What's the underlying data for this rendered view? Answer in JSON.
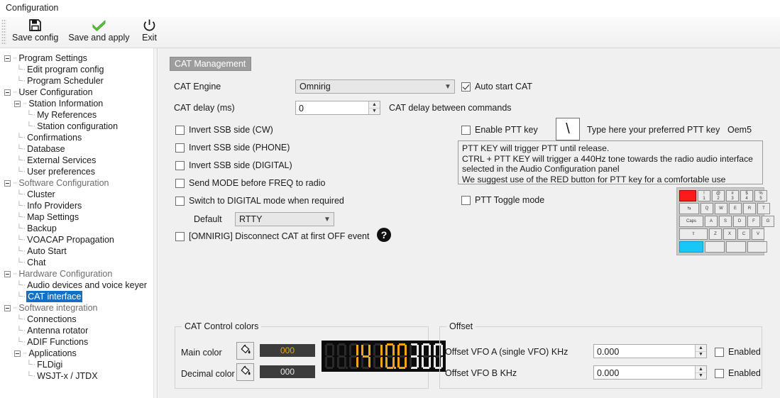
{
  "window": {
    "title": "Configuration"
  },
  "toolbar": {
    "items": [
      {
        "label": "Save config",
        "icon": "floppy-disk-icon"
      },
      {
        "label": "Save and apply",
        "icon": "green-check-icon"
      },
      {
        "label": "Exit",
        "icon": "power-icon"
      }
    ]
  },
  "sidebar": {
    "items": [
      {
        "label": "Program Settings",
        "indent": 0,
        "expander": true,
        "grey": false,
        "selected": false
      },
      {
        "label": "Edit program config",
        "indent": 1,
        "expander": false,
        "grey": false,
        "selected": false
      },
      {
        "label": "Program Scheduler",
        "indent": 1,
        "expander": false,
        "grey": false,
        "selected": false
      },
      {
        "label": "User Configuration",
        "indent": 0,
        "expander": true,
        "grey": false,
        "selected": false
      },
      {
        "label": "Station Information",
        "indent": 1,
        "expander": true,
        "grey": false,
        "selected": false
      },
      {
        "label": "My References",
        "indent": 2,
        "expander": false,
        "grey": false,
        "selected": false
      },
      {
        "label": "Station configuration",
        "indent": 2,
        "expander": false,
        "grey": false,
        "selected": false
      },
      {
        "label": "Confirmations",
        "indent": 1,
        "expander": false,
        "grey": false,
        "selected": false
      },
      {
        "label": "Database",
        "indent": 1,
        "expander": false,
        "grey": false,
        "selected": false
      },
      {
        "label": "External Services",
        "indent": 1,
        "expander": false,
        "grey": false,
        "selected": false
      },
      {
        "label": "User preferences",
        "indent": 1,
        "expander": false,
        "grey": false,
        "selected": false
      },
      {
        "label": "Software Configuration",
        "indent": 0,
        "expander": true,
        "grey": true,
        "selected": false
      },
      {
        "label": "Cluster",
        "indent": 1,
        "expander": false,
        "grey": false,
        "selected": false
      },
      {
        "label": "Info Providers",
        "indent": 1,
        "expander": false,
        "grey": false,
        "selected": false
      },
      {
        "label": "Map Settings",
        "indent": 1,
        "expander": false,
        "grey": false,
        "selected": false
      },
      {
        "label": "Backup",
        "indent": 1,
        "expander": false,
        "grey": false,
        "selected": false
      },
      {
        "label": "VOACAP Propagation",
        "indent": 1,
        "expander": false,
        "grey": false,
        "selected": false
      },
      {
        "label": "Auto Start",
        "indent": 1,
        "expander": false,
        "grey": false,
        "selected": false
      },
      {
        "label": "Chat",
        "indent": 1,
        "expander": false,
        "grey": false,
        "selected": false
      },
      {
        "label": "Hardware Configuration",
        "indent": 0,
        "expander": true,
        "grey": true,
        "selected": false
      },
      {
        "label": "Audio devices and voice keyer",
        "indent": 1,
        "expander": false,
        "grey": false,
        "selected": false
      },
      {
        "label": "CAT interface",
        "indent": 1,
        "expander": false,
        "grey": false,
        "selected": true
      },
      {
        "label": "Software integration",
        "indent": 0,
        "expander": true,
        "grey": true,
        "selected": false
      },
      {
        "label": "Connections",
        "indent": 1,
        "expander": false,
        "grey": false,
        "selected": false
      },
      {
        "label": "Antenna rotator",
        "indent": 1,
        "expander": false,
        "grey": false,
        "selected": false
      },
      {
        "label": "ADIF Functions",
        "indent": 1,
        "expander": false,
        "grey": false,
        "selected": false
      },
      {
        "label": "Applications",
        "indent": 1,
        "expander": true,
        "grey": false,
        "selected": false
      },
      {
        "label": "FLDigi",
        "indent": 2,
        "expander": false,
        "grey": false,
        "selected": false
      },
      {
        "label": "WSJT-x / JTDX",
        "indent": 2,
        "expander": false,
        "grey": false,
        "selected": false
      }
    ]
  },
  "main": {
    "group_title": "CAT Management",
    "cat_engine": {
      "label": "CAT Engine",
      "value": "Omnirig"
    },
    "cat_delay": {
      "label": "CAT delay (ms)",
      "value": "0",
      "hint": "CAT delay between commands"
    },
    "auto_start_cat": {
      "label": "Auto start CAT",
      "checked": true
    },
    "checkboxes": [
      {
        "label": "Invert SSB side (CW)",
        "checked": false
      },
      {
        "label": "Invert SSB side (PHONE)",
        "checked": false
      },
      {
        "label": "Invert SSB side (DIGITAL)",
        "checked": false
      },
      {
        "label": "Send MODE before FREQ to radio",
        "checked": false
      },
      {
        "label": "Switch to DIGITAL mode when required",
        "checked": false
      }
    ],
    "default_mode": {
      "label": "Default",
      "value": "RTTY"
    },
    "omnirig_disconnect": {
      "label": "[OMNIRIG] Disconnect CAT at first OFF event",
      "checked": false
    },
    "help_icon": "question-mark-icon",
    "enable_ptt_key": {
      "label": "Enable PTT key",
      "checked": false
    },
    "ptt_key_box": {
      "value": "\\"
    },
    "ptt_key_hint": "Type here your preferred PTT key",
    "ptt_key_name": "Oem5",
    "ptt_info_lines": [
      "PTT KEY will trigger PTT until release.",
      "CTRL + PTT KEY will trigger a 440Hz tone towards the radio audio interface",
      "selected in the Audio Configuration panel",
      "We suggest use of the RED button for PTT key for a comfortable use"
    ],
    "ptt_toggle_mode": {
      "label": "PTT Toggle mode",
      "checked": false
    },
    "keyboard": {
      "rows": [
        [
          {
            "cap": "",
            "w": "w24",
            "color": "red"
          },
          {
            "cap": "!\n1",
            "w": "w18"
          },
          {
            "cap": "@\n2",
            "w": "w18"
          },
          {
            "cap": "#\n3",
            "w": "w18"
          },
          {
            "cap": "$\n4",
            "w": "w18"
          },
          {
            "cap": "%\n5",
            "w": "w18"
          }
        ],
        [
          {
            "cap": "⇆",
            "w": "w28"
          },
          {
            "cap": "Q",
            "w": "w18"
          },
          {
            "cap": "W",
            "w": "w18"
          },
          {
            "cap": "E",
            "w": "w18"
          },
          {
            "cap": "R",
            "w": "w18"
          },
          {
            "cap": "T",
            "w": "w18"
          }
        ],
        [
          {
            "cap": "Caps",
            "w": "w34"
          },
          {
            "cap": "A",
            "w": "w18"
          },
          {
            "cap": "S",
            "w": "w18"
          },
          {
            "cap": "D",
            "w": "w18"
          },
          {
            "cap": "F",
            "w": "w18"
          },
          {
            "cap": "G",
            "w": "w18"
          }
        ],
        [
          {
            "cap": "⇧",
            "w": "w40"
          },
          {
            "cap": "Z",
            "w": "w18"
          },
          {
            "cap": "X",
            "w": "w18"
          },
          {
            "cap": "C",
            "w": "w18"
          },
          {
            "cap": "V",
            "w": "w18"
          }
        ],
        [
          {
            "cap": "",
            "w": "w34",
            "color": "cyan"
          },
          {
            "cap": "",
            "w": "w28"
          },
          {
            "cap": "",
            "w": "w28"
          },
          {
            "cap": "",
            "w": "w28"
          }
        ]
      ]
    }
  },
  "cat_colors": {
    "caption": "CAT Control colors",
    "main_color": {
      "label": "Main color",
      "value": "000",
      "swatch_color": "#f0a515",
      "icon": "paint-bucket-icon"
    },
    "decimal_color": {
      "label": "Decimal color",
      "value": "000",
      "swatch_color": "#e8e8e8",
      "icon": "paint-bucket-icon"
    },
    "display": {
      "digits": [
        {
          "char": "8",
          "style": "off",
          "dot": false
        },
        {
          "char": "8",
          "style": "off",
          "dot": true
        },
        {
          "char": "1",
          "style": "main",
          "dot": false
        },
        {
          "char": "4",
          "style": "main",
          "dot": false
        },
        {
          "char": "1",
          "style": "main",
          "dot": false
        },
        {
          "char": "0",
          "style": "main",
          "dot": true
        },
        {
          "char": "0",
          "style": "main",
          "dot": false
        },
        {
          "char": "3",
          "style": "dec",
          "dot": false
        },
        {
          "char": "0",
          "style": "dec",
          "dot": false
        },
        {
          "char": "0",
          "style": "dec",
          "dot": false
        }
      ]
    }
  },
  "offset": {
    "caption": "Offset",
    "rows": [
      {
        "label": "Offset VFO A (single VFO) KHz",
        "value": "0.000",
        "enabled_label": "Enabled",
        "checked": false
      },
      {
        "label": "Offset VFO B KHz",
        "value": "0.000",
        "enabled_label": "Enabled",
        "checked": false
      }
    ]
  }
}
